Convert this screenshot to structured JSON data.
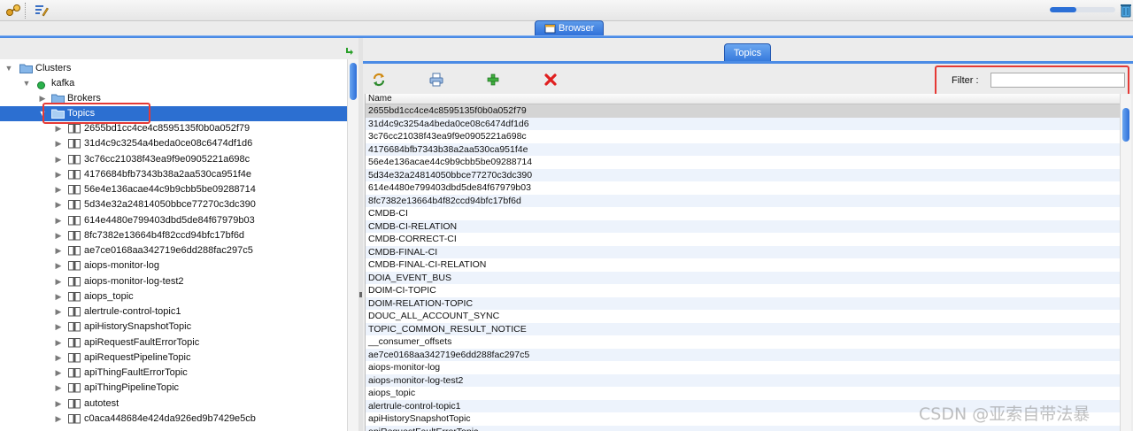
{
  "toolbar": {
    "icons": [
      "connect-icon",
      "edit-icon",
      "trash-icon"
    ],
    "progress_fraction": 0.4
  },
  "tabs": {
    "browser_label": "Browser",
    "topics_label": "Topics"
  },
  "tree": {
    "clusters_label": "Clusters",
    "cluster_name": "kafka",
    "cluster_status_color": "#2bb24c",
    "brokers_label": "Brokers",
    "topics_label": "Topics",
    "topic_items": [
      "2655bd1cc4ce4c8595135f0b0a052f79",
      "31d4c9c3254a4beda0ce08c6474df1d6",
      "3c76cc21038f43ea9f9e0905221a698c",
      "4176684bfb7343b38a2aa530ca951f4e",
      "56e4e136acae44c9b9cbb5be09288714",
      "5d34e32a24814050bbce77270c3dc390",
      "614e4480e799403dbd5de84f67979b03",
      "8fc7382e13664b4f82ccd94bfc17bf6d",
      "ae7ce0168aa342719e6dd288fac297c5",
      "aiops-monitor-log",
      "aiops-monitor-log-test2",
      "aiops_topic",
      "alertrule-control-topic1",
      "apiHistorySnapshotTopic",
      "apiRequestFaultErrorTopic",
      "apiRequestPipelineTopic",
      "apiThingFaultErrorTopic",
      "apiThingPipelineTopic",
      "autotest",
      "c0aca448684e424da926ed9b7429e5cb"
    ]
  },
  "topics_panel": {
    "filter_label": "Filter :",
    "filter_value": "",
    "column_header": "Name",
    "rows": [
      "2655bd1cc4ce4c8595135f0b0a052f79",
      "31d4c9c3254a4beda0ce08c6474df1d6",
      "3c76cc21038f43ea9f9e0905221a698c",
      "4176684bfb7343b38a2aa530ca951f4e",
      "56e4e136acae44c9b9cbb5be09288714",
      "5d34e32a24814050bbce77270c3dc390",
      "614e4480e799403dbd5de84f67979b03",
      "8fc7382e13664b4f82ccd94bfc17bf6d",
      "CMDB-CI",
      "CMDB-CI-RELATION",
      "CMDB-CORRECT-CI",
      "CMDB-FINAL-CI",
      "CMDB-FINAL-CI-RELATION",
      "DOIA_EVENT_BUS",
      "DOIM-CI-TOPIC",
      "DOIM-RELATION-TOPIC",
      "DOUC_ALL_ACCOUNT_SYNC",
      "TOPIC_COMMON_RESULT_NOTICE",
      "__consumer_offsets",
      "ae7ce0168aa342719e6dd288fac297c5",
      "aiops-monitor-log",
      "aiops-monitor-log-test2",
      "aiops_topic",
      "alertrule-control-topic1",
      "apiHistorySnapshotTopic",
      "apiRequestFaultErrorTopic"
    ]
  },
  "watermark": "CSDN @亚索自带法暴",
  "colors": {
    "accent": "#2c6fd1",
    "highlight": "#e53935"
  }
}
